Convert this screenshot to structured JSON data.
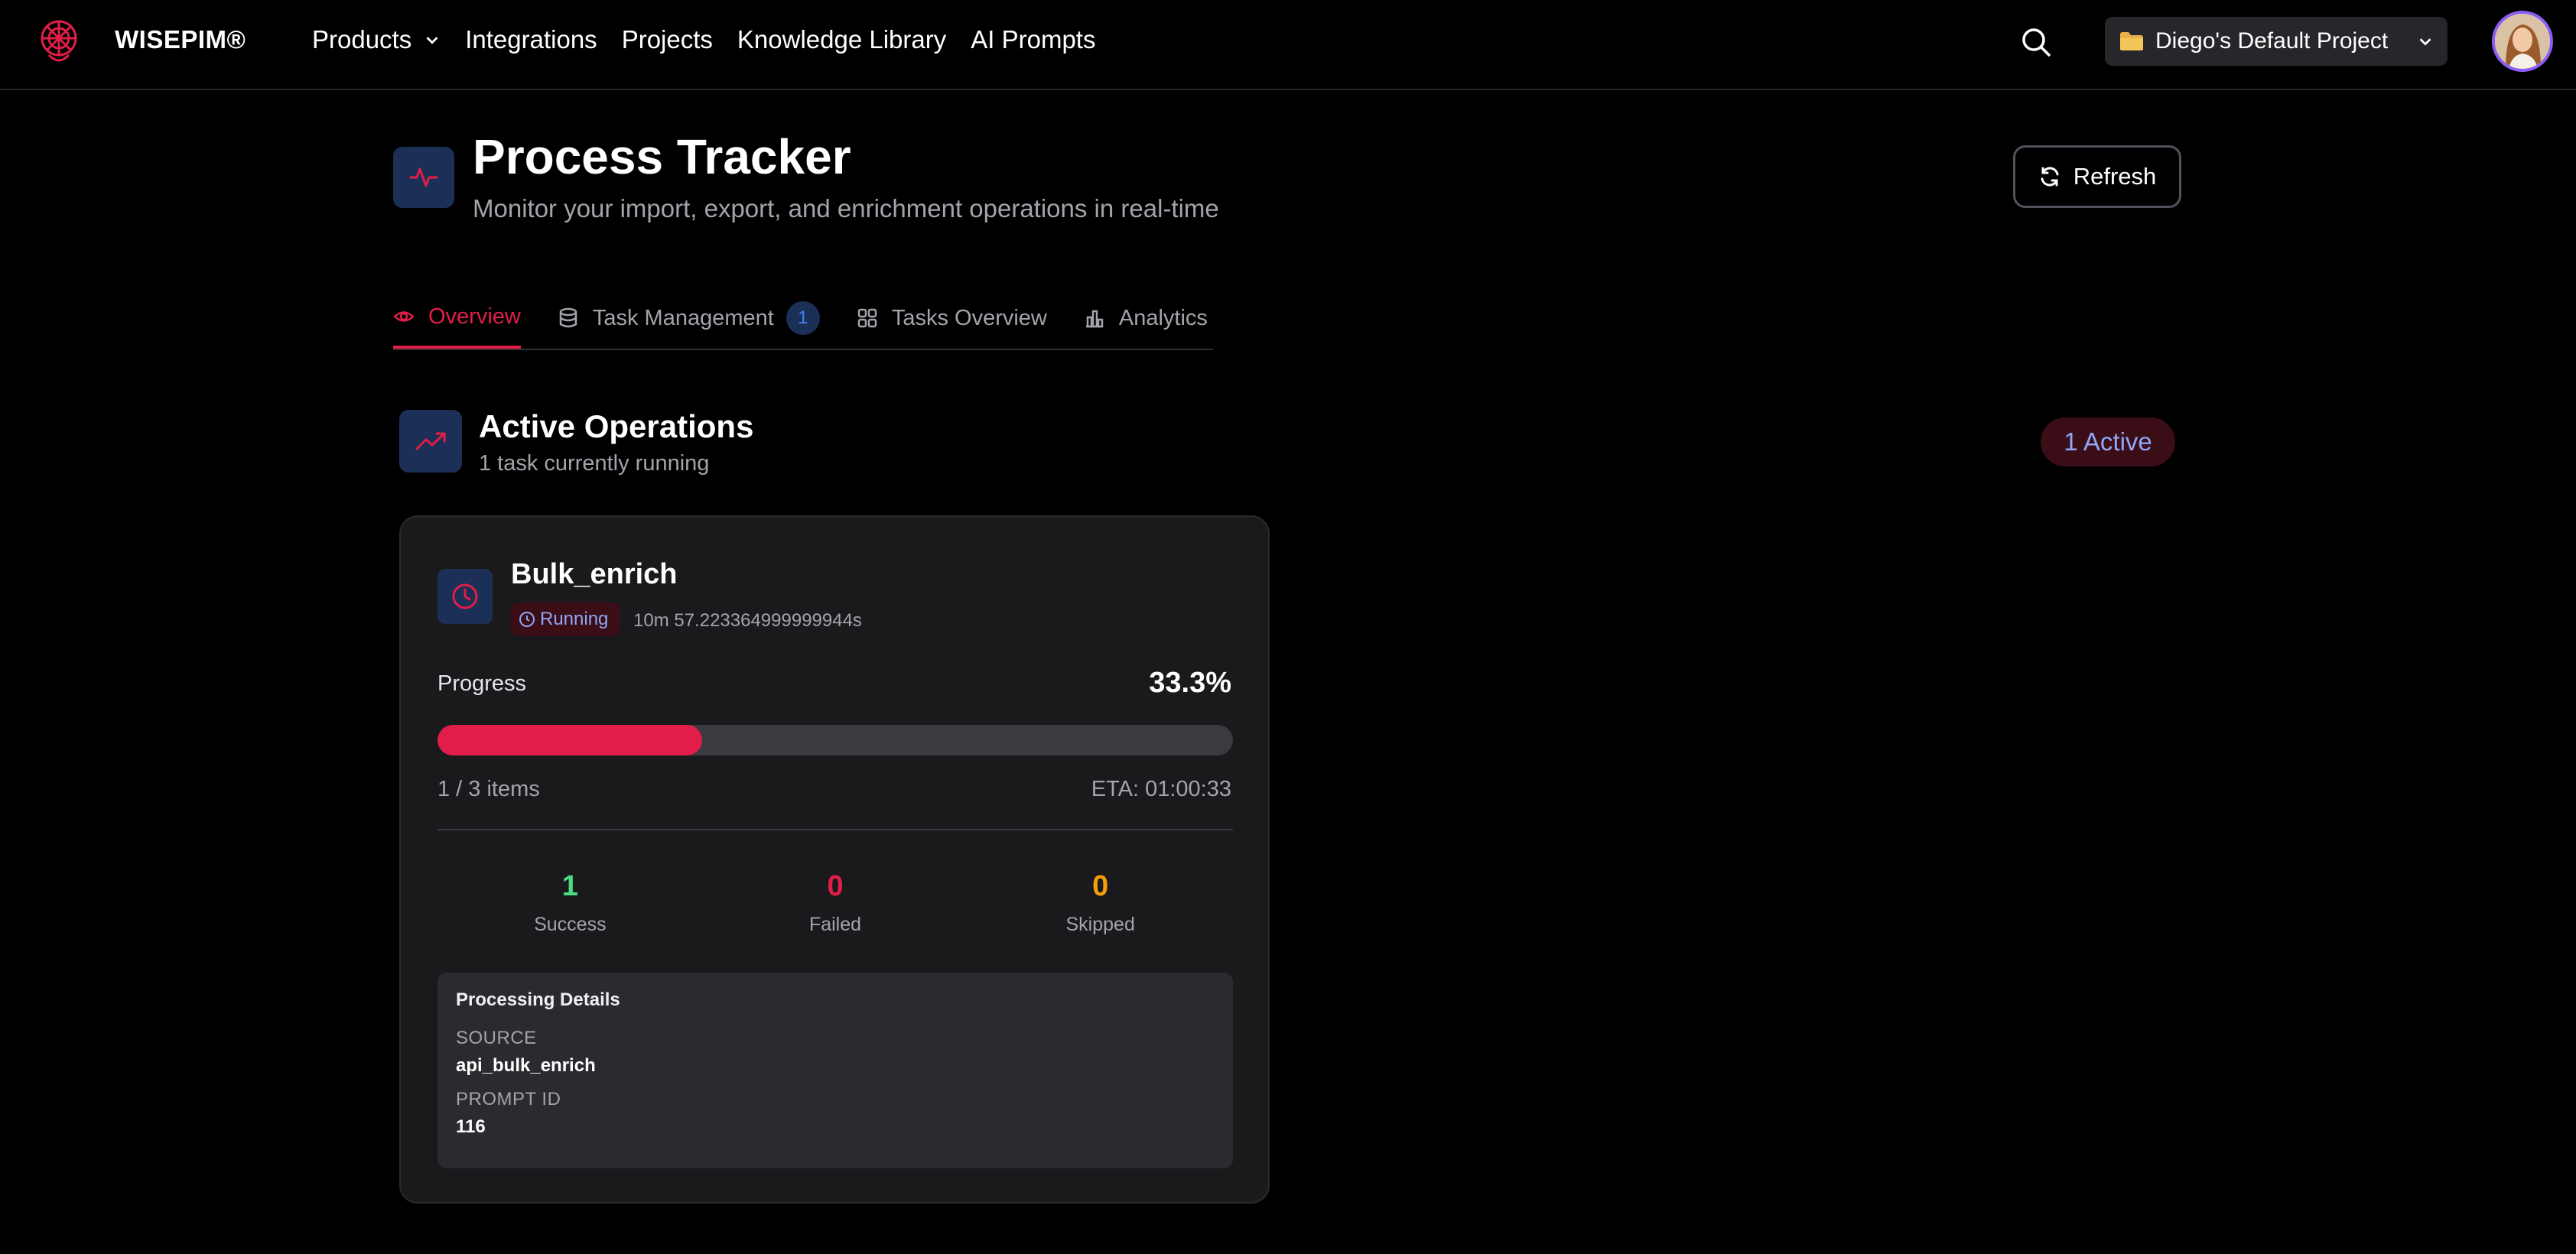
{
  "header": {
    "brand": "WISEPIM®",
    "nav": [
      {
        "label": "Products",
        "has_dropdown": true
      },
      {
        "label": "Integrations"
      },
      {
        "label": "Projects"
      },
      {
        "label": "Knowledge Library"
      },
      {
        "label": "AI Prompts"
      }
    ],
    "project_selector": "Diego's Default Project",
    "icons": {
      "logo": "brain-logo-icon",
      "search": "search-icon",
      "project": "folder-icon"
    }
  },
  "page": {
    "title": "Process Tracker",
    "subtitle": "Monitor your import, export, and enrichment operations in real-time",
    "refresh_label": "Refresh"
  },
  "tabs": [
    {
      "label": "Overview",
      "icon": "eye-icon",
      "active": true
    },
    {
      "label": "Task Management",
      "icon": "database-icon",
      "badge": "1"
    },
    {
      "label": "Tasks Overview",
      "icon": "grid-icon"
    },
    {
      "label": "Analytics",
      "icon": "bar-chart-icon"
    }
  ],
  "active_operations": {
    "title": "Active Operations",
    "subtitle": "1 task currently running",
    "count_badge": "1 Active"
  },
  "task": {
    "name": "Bulk_enrich",
    "status": "Running",
    "elapsed": "10m 57.223364999999944s",
    "progress_label": "Progress",
    "progress_pct_text": "33.3%",
    "progress_fraction": 0.333,
    "items_text": "1 / 3 items",
    "eta": "ETA: 01:00:33",
    "stats": {
      "success": {
        "value": "1",
        "label": "Success"
      },
      "failed": {
        "value": "0",
        "label": "Failed"
      },
      "skipped": {
        "value": "0",
        "label": "Skipped"
      }
    },
    "details": {
      "title": "Processing Details",
      "source_label": "SOURCE",
      "source_value": "api_bulk_enrich",
      "prompt_label": "PROMPT ID",
      "prompt_value": "116"
    }
  },
  "colors": {
    "accent": "#e11d48",
    "icon_bg": "#1c2f57",
    "success": "#4ade80",
    "skipped": "#f59e0b"
  }
}
